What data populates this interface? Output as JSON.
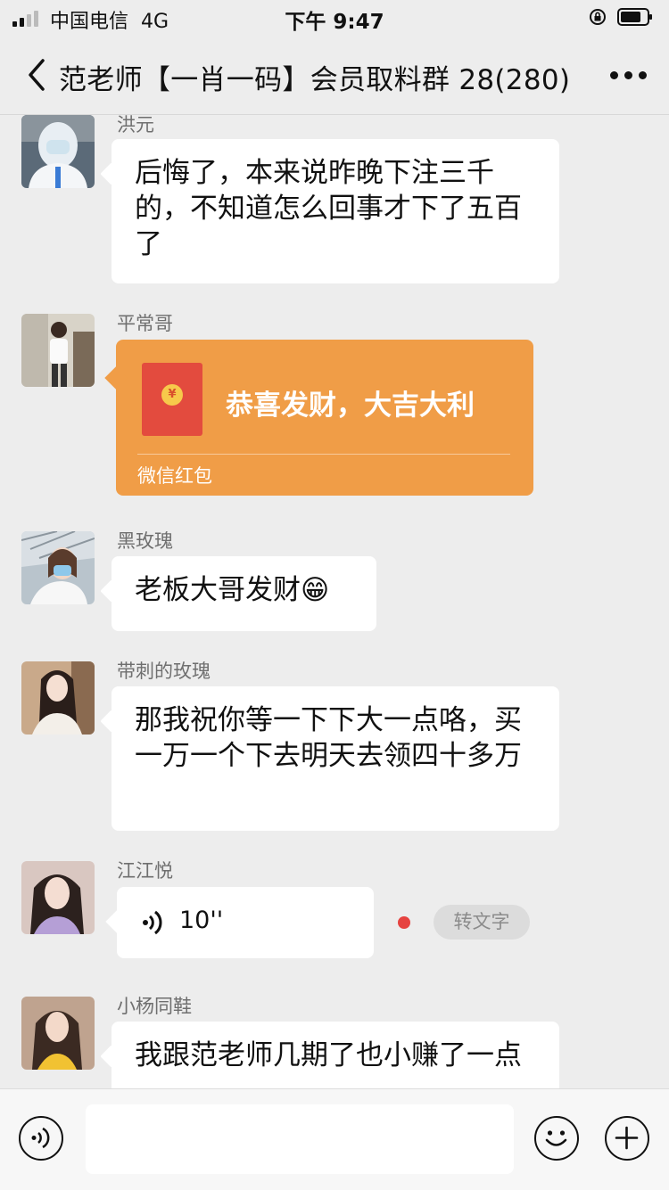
{
  "status": {
    "carrier": "中国电信",
    "network": "4G",
    "time": "下午 9:47"
  },
  "nav": {
    "title": "范老师【一肖一码】会员取料群 28(280)"
  },
  "messages": [
    {
      "sender": "洪元",
      "text": "后悔了，本来说昨晚下注三千的，不知道怎么回事才下了五百了"
    },
    {
      "sender": "平常哥",
      "red_packet_text": "恭喜发财，大吉大利",
      "red_packet_label": "微信红包",
      "coin": "¥"
    },
    {
      "sender": "黑玫瑰",
      "text": "老板大哥发财😁"
    },
    {
      "sender": "带刺的玫瑰",
      "text": "那我祝你等一下下大一点咯，买一万一个下去明天去领四十多万"
    },
    {
      "sender": "江江悦",
      "voice_duration": "10''",
      "to_text": "转文字"
    },
    {
      "sender": "小杨同鞋",
      "text": "我跟范老师几期了也小赚了一点"
    }
  ],
  "colors": {
    "red_packet": "#f09d47",
    "unread": "#e64340",
    "background": "#ededed"
  }
}
